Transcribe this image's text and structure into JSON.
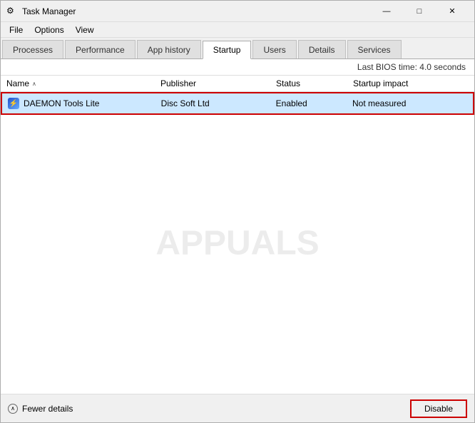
{
  "window": {
    "title": "Task Manager",
    "icon": "⚙"
  },
  "title_buttons": {
    "minimize": "—",
    "maximize": "□",
    "close": "✕"
  },
  "menu": {
    "items": [
      "File",
      "Options",
      "View"
    ]
  },
  "tabs": [
    {
      "label": "Processes",
      "active": false
    },
    {
      "label": "Performance",
      "active": false
    },
    {
      "label": "App history",
      "active": false
    },
    {
      "label": "Startup",
      "active": true
    },
    {
      "label": "Users",
      "active": false
    },
    {
      "label": "Details",
      "active": false
    },
    {
      "label": "Services",
      "active": false
    }
  ],
  "bios_time": {
    "label": "Last BIOS time:",
    "value": "4.0 seconds"
  },
  "columns": {
    "name": "Name",
    "publisher": "Publisher",
    "status": "Status",
    "startup_impact": "Startup impact"
  },
  "sort_arrow": "∧",
  "rows": [
    {
      "name": "DAEMON Tools Lite",
      "publisher": "Disc Soft Ltd",
      "status": "Enabled",
      "impact": "Not measured",
      "selected": true
    }
  ],
  "footer": {
    "fewer_details": "Fewer details",
    "disable_button": "Disable"
  },
  "watermark": "APPUALS"
}
